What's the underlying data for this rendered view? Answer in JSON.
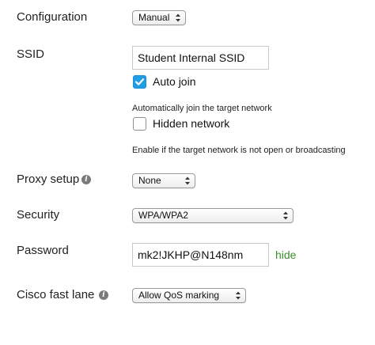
{
  "configuration": {
    "label": "Configuration",
    "value": "Manual"
  },
  "ssid": {
    "label": "SSID",
    "value": "Student Internal SSID",
    "auto_join": {
      "label": "Auto join",
      "checked": true,
      "hint": "Automatically join the target network"
    },
    "hidden_network": {
      "label": "Hidden network",
      "checked": false,
      "hint": "Enable if the target network is not open or broadcasting"
    }
  },
  "proxy_setup": {
    "label": "Proxy setup",
    "value": "None",
    "icon": "info-icon"
  },
  "security": {
    "label": "Security",
    "value": "WPA/WPA2"
  },
  "password": {
    "label": "Password",
    "value": "mk2!JKHP@N148nm",
    "toggle_label": "hide"
  },
  "cisco_fast_lane": {
    "label": "Cisco fast lane",
    "value": "Allow QoS marking",
    "icon": "info-icon"
  },
  "colors": {
    "checkbox_checked": "#1f9ee6",
    "link_green": "#3a8f2a",
    "info_icon": "#7a7a7a"
  }
}
